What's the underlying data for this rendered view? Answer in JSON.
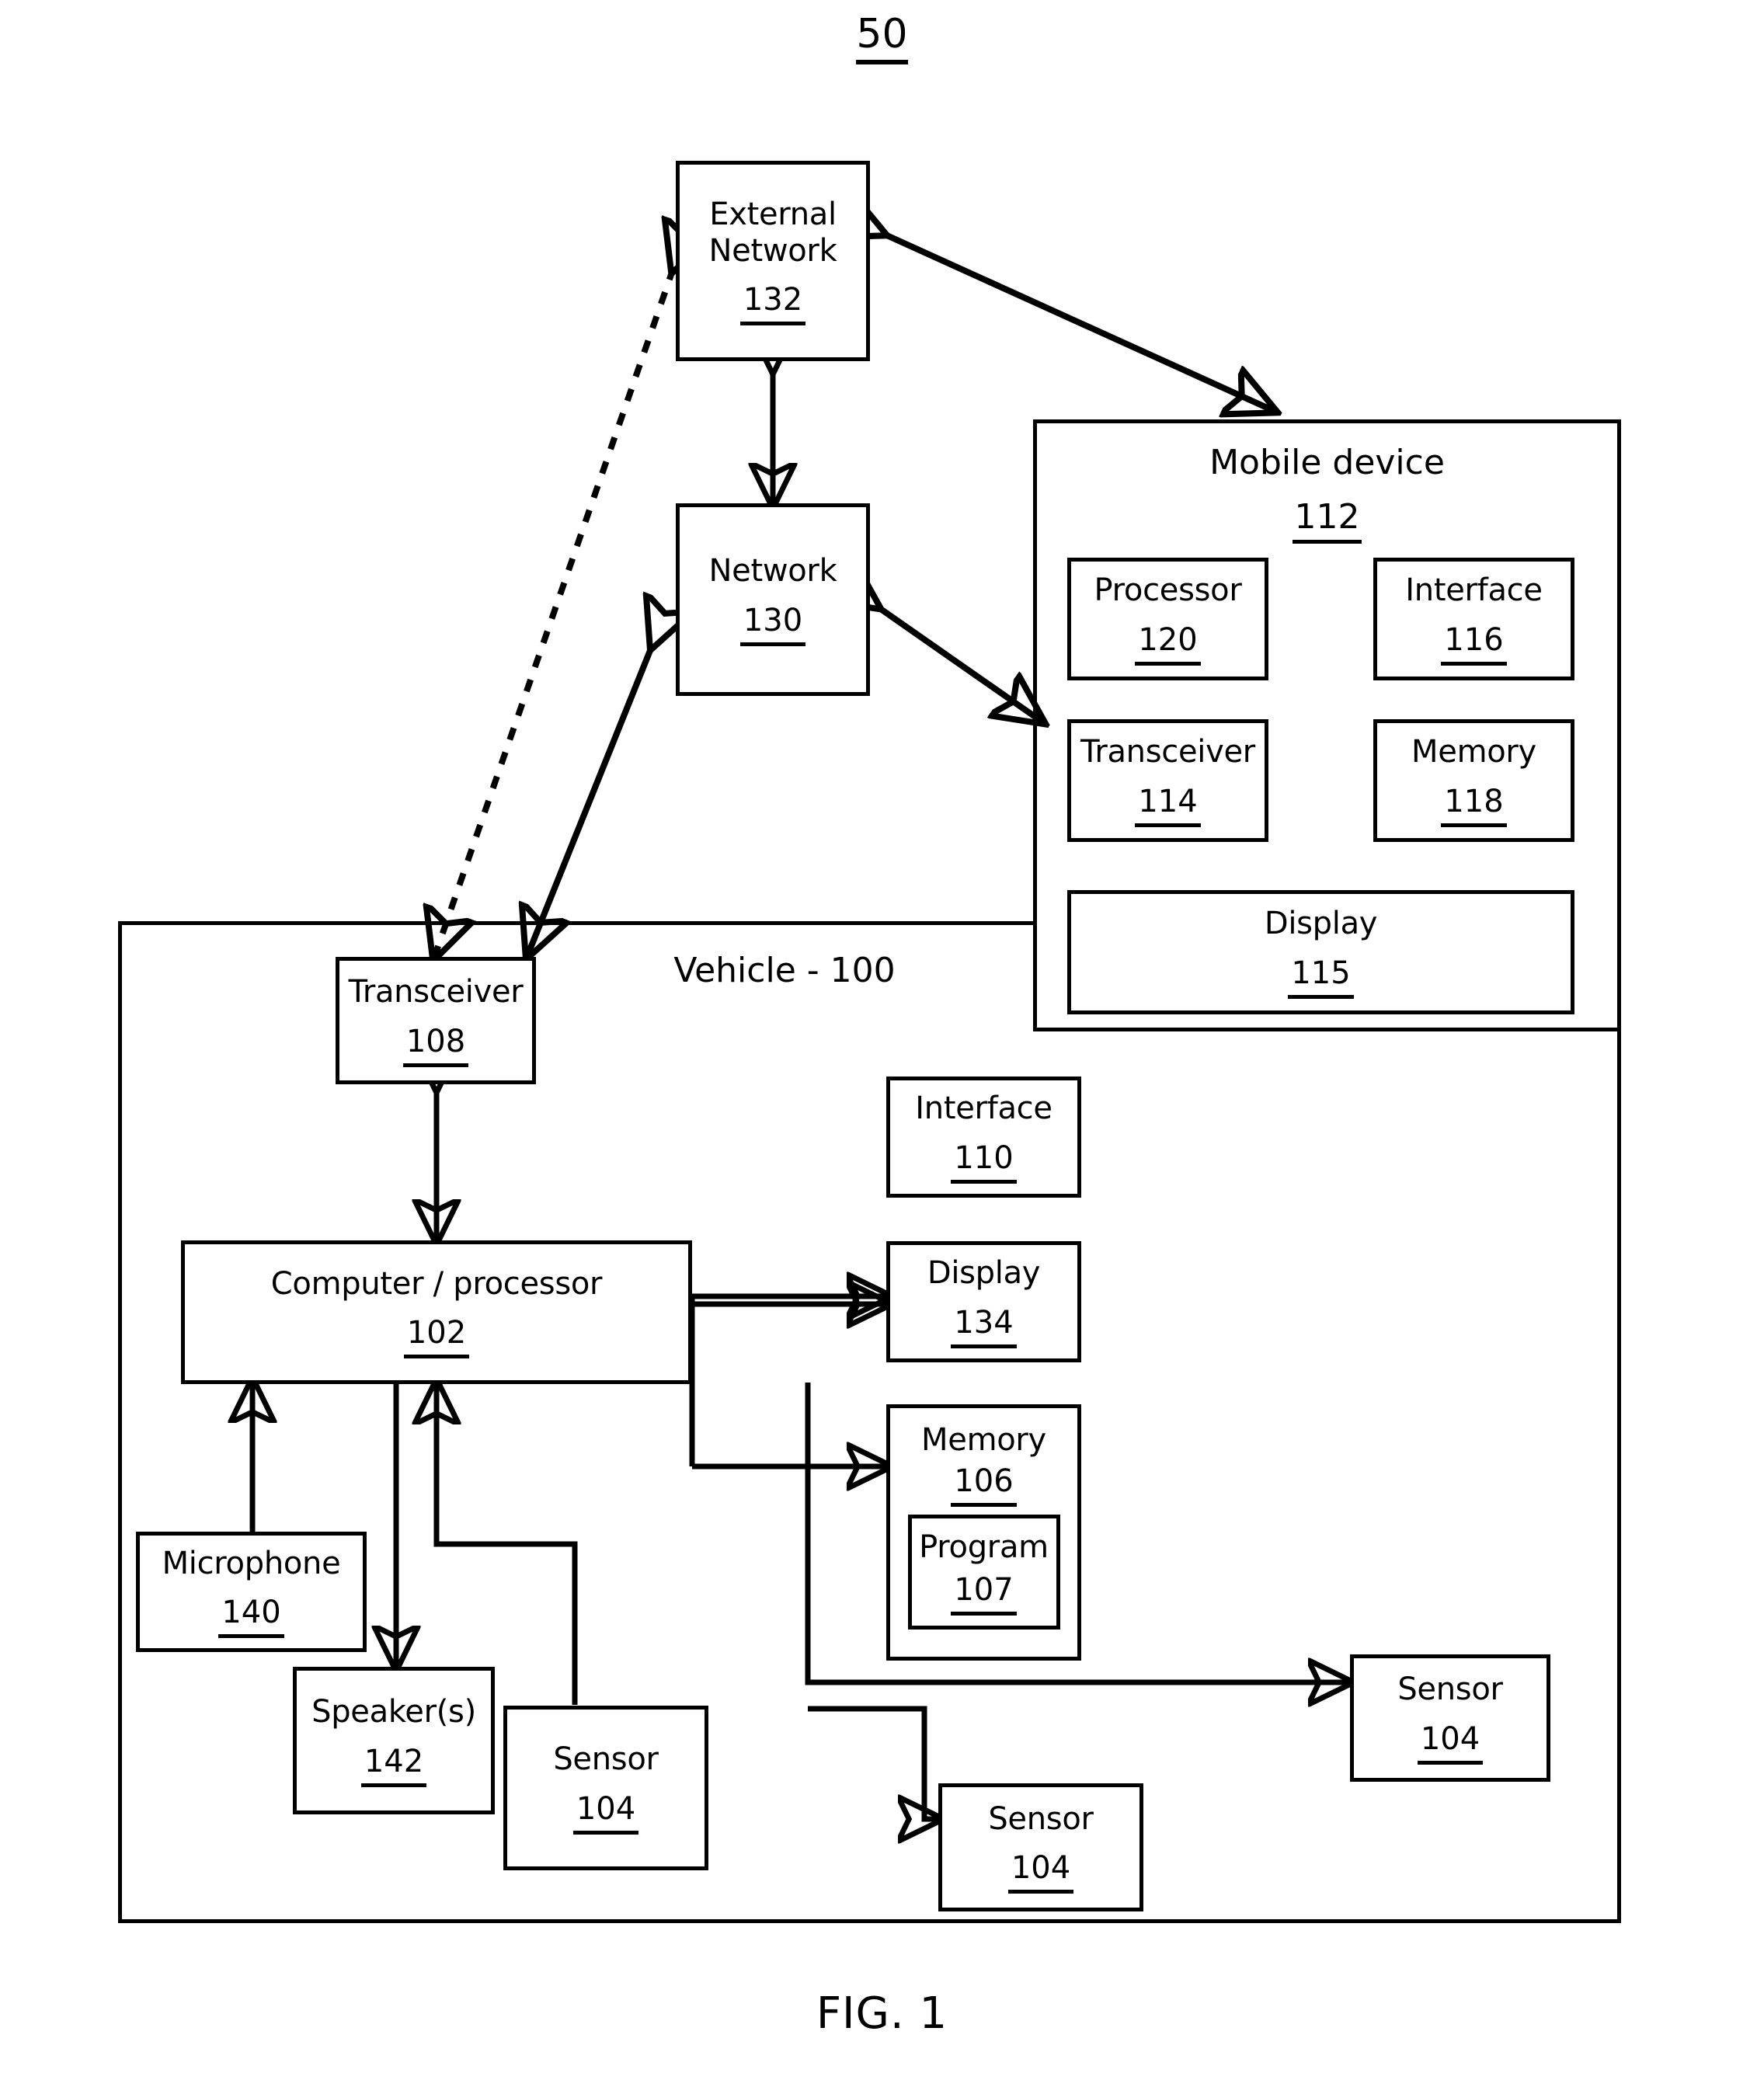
{
  "figure": {
    "top_number": "50",
    "caption": "FIG. 1"
  },
  "external_network": {
    "label": "External\nNetwork",
    "line1": "External",
    "line2": "Network",
    "number": "132"
  },
  "network": {
    "label": "Network",
    "number": "130"
  },
  "mobile_device": {
    "title": "Mobile device",
    "number": "112",
    "components": [
      {
        "label": "Processor",
        "number": "120"
      },
      {
        "label": "Interface",
        "number": "116"
      },
      {
        "label": "Transceiver",
        "number": "114"
      },
      {
        "label": "Memory",
        "number": "118"
      },
      {
        "label": "Display",
        "number": "115"
      }
    ]
  },
  "vehicle": {
    "label": "Vehicle - 100",
    "components": [
      {
        "label": "Transceiver",
        "number": "108"
      },
      {
        "label": "Computer / processor",
        "number": "102"
      },
      {
        "label": "Interface",
        "number": "110"
      },
      {
        "label": "Display",
        "number": "134"
      },
      {
        "label": "Memory",
        "number": "106"
      },
      {
        "label": "Program",
        "number": "107"
      },
      {
        "label": "Microphone",
        "number": "140"
      },
      {
        "label": "Speaker(s)",
        "number": "142"
      },
      {
        "label": "Sensor",
        "number": "104"
      },
      {
        "label": "Sensor",
        "number": "104"
      },
      {
        "label": "Sensor",
        "number": "104"
      }
    ]
  },
  "colors": {
    "ink": "#000000",
    "paper": "#ffffff"
  }
}
